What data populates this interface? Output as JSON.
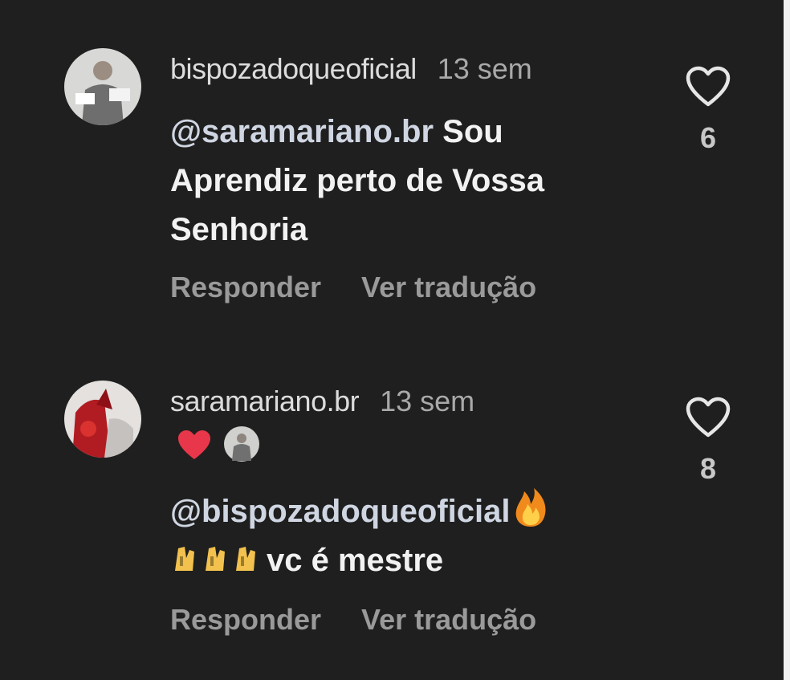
{
  "comments": [
    {
      "username": "bispozadoqueoficial",
      "time": "13 sem",
      "mention": "@saramariano.br",
      "line1_rest": "Sou",
      "line2": "Aprendiz perto de Vossa",
      "line3": "Senhoria",
      "reply_label": "Responder",
      "translate_label": "Ver tradução",
      "likes": "6",
      "avatar_icon": "profile-photo-grey"
    },
    {
      "username": "saramariano.br",
      "time": "13 sem",
      "reaction_icons": [
        "red-heart-icon",
        "author-avatar-icon"
      ],
      "mention": "@bispozadoqueoficial",
      "line1_emoji": "fire-emoji",
      "line2_emojis": "clapping-emojis",
      "line2_text": "vc é mestre",
      "reply_label": "Responder",
      "translate_label": "Ver tradução",
      "likes": "8",
      "avatar_icon": "profile-photo-red"
    }
  ],
  "colors": {
    "background": "#1f1f1f",
    "text": "#f2f2f2",
    "muted": "#9a9a9a",
    "heart_red": "#e8374a",
    "fire": "#f5a623"
  }
}
